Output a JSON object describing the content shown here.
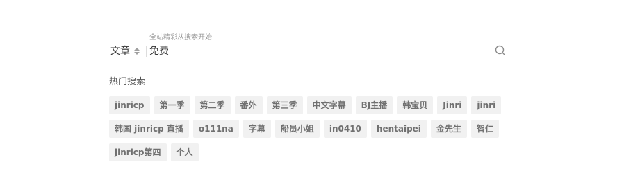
{
  "search": {
    "hint": "全站精彩从搜索开始",
    "type_label": "文章",
    "value": "免费"
  },
  "hot": {
    "title": "热门搜索",
    "tags": [
      "jinricp",
      "第一季",
      "第二季",
      "番外",
      "第三季",
      "中文字幕",
      "BJ主播",
      "韩宝贝",
      "Jinri",
      "jinri",
      "韩国 jinricp 直播",
      "o111na",
      "字幕",
      "船员小姐",
      "in0410",
      "hentaipei",
      "金先生",
      "智仁",
      "jinricp第四",
      "个人"
    ]
  },
  "icons": {
    "search": "search-icon",
    "sort": "sort-updown-icon"
  },
  "colors": {
    "tag_bg": "#f1f1f1",
    "tag_text": "#707070",
    "hint_text": "#9a9a9a"
  }
}
